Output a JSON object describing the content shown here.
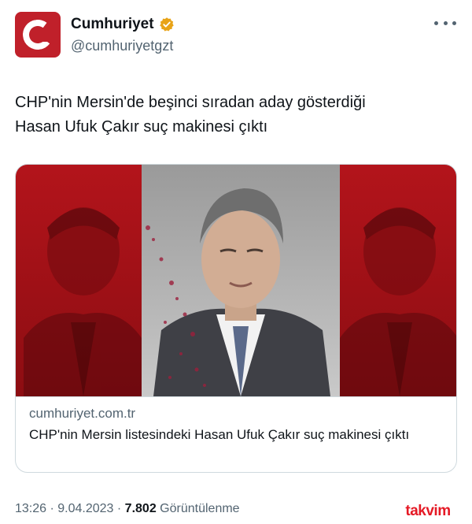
{
  "account": {
    "display_name": "Cumhuriyet",
    "handle": "@cumhuriyetgzt",
    "verified_color": "#e8a317",
    "avatar_color": "#c0202a"
  },
  "tweet": {
    "text_line1": "CHP'nin Mersin'de beşinci sıradan aday gösterdiği",
    "text_line2": "Hasan Ufuk Çakır suç makinesi çıktı"
  },
  "link_card": {
    "domain": "cumhuriyet.com.tr",
    "title": "CHP'nin Mersin listesindeki Hasan Ufuk Çakır suç makinesi çıktı"
  },
  "footer": {
    "time": "13:26",
    "separator": " · ",
    "date": "9.04.2023",
    "views_count": "7.802",
    "views_label": "Görüntülenme"
  },
  "watermark": "takvim"
}
